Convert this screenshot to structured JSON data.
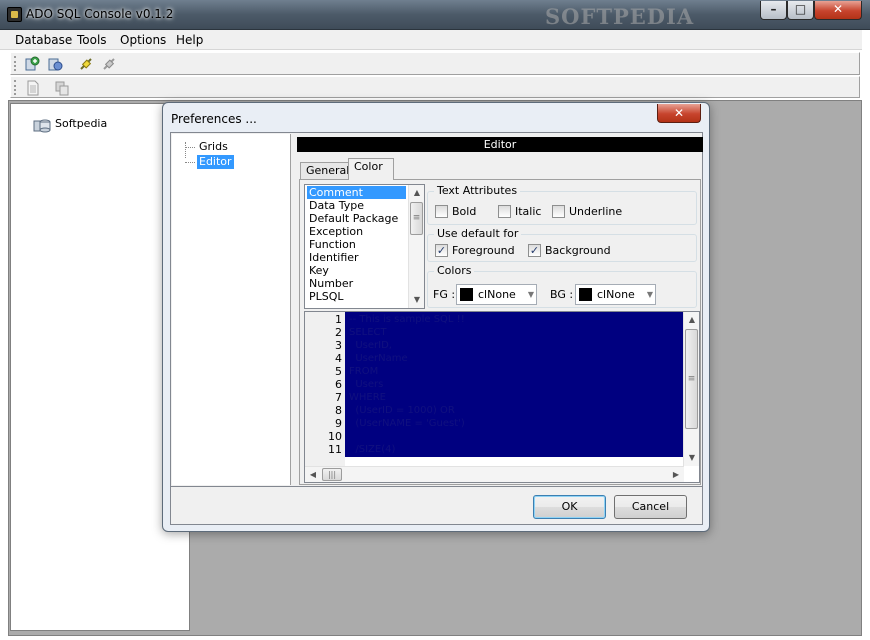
{
  "window": {
    "title": "ADO SQL Console v0.1.2",
    "watermark": "SOFTPEDIA"
  },
  "menu": [
    "Database",
    "Tools",
    "Options",
    "Help"
  ],
  "tree": {
    "root": "Softpedia"
  },
  "dialog": {
    "title": "Preferences ...",
    "nav": [
      "Grids",
      "Editor"
    ],
    "header": "Editor",
    "tabs": [
      "General",
      "Color"
    ],
    "categories": [
      "Comment",
      "Data Type",
      "Default Package",
      "Exception",
      "Function",
      "Identifier",
      "Key",
      "Number",
      "PLSQL"
    ],
    "text_attributes": {
      "title": "Text Attributes",
      "bold": "Bold",
      "italic": "Italic",
      "underline": "Underline"
    },
    "use_default": {
      "title": "Use default for",
      "foreground": "Foreground",
      "background": "Background"
    },
    "colors": {
      "title": "Colors",
      "fg_label": "FG :",
      "fg_value": "clNone",
      "bg_label": "BG :",
      "bg_value": "clNone"
    },
    "code_lines": [
      "-- This is sample SQL !!",
      "SELECT",
      "  UserID,",
      "  UserName",
      "FROM",
      "  Users",
      "WHERE",
      "  (UserID = 1000) OR",
      "  (UserNAME = 'Guest')",
      "",
      "  /SIZE(4)"
    ],
    "line_numbers": [
      "1",
      "2",
      "3",
      "4",
      "5",
      "6",
      "7",
      "8",
      "9",
      "10",
      "11"
    ],
    "ok": "OK",
    "cancel": "Cancel"
  },
  "colors": {
    "selection": "#3399ff",
    "code_background": "#000080"
  }
}
